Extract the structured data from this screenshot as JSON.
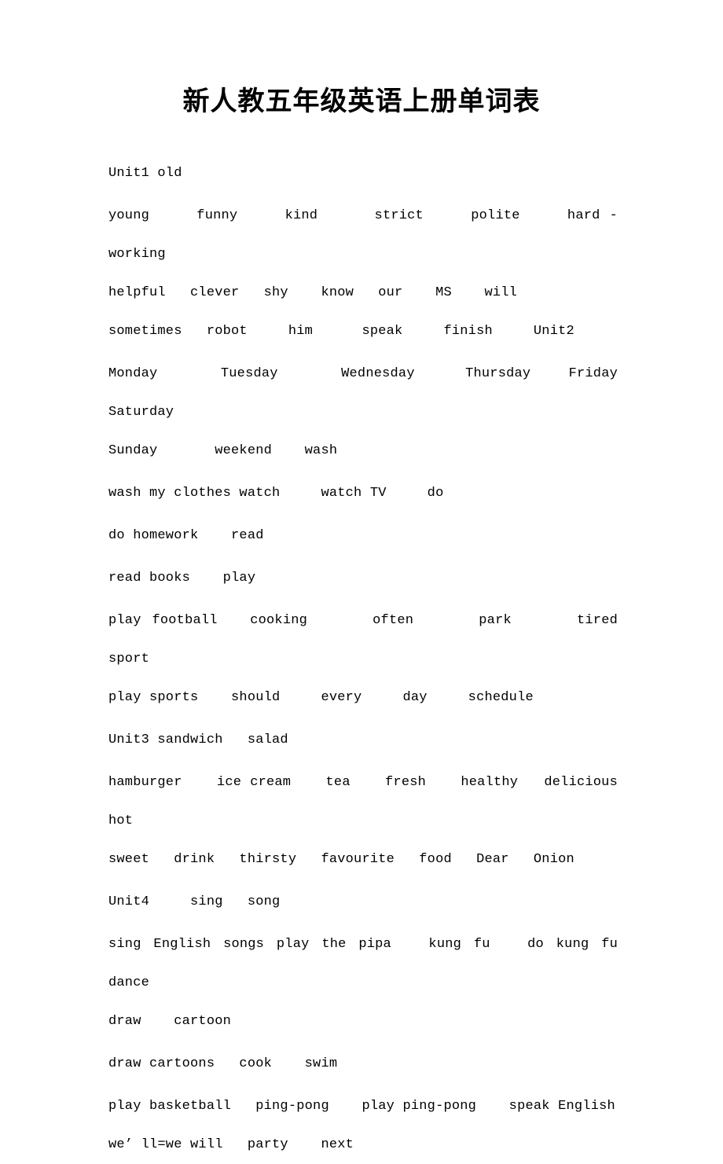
{
  "document": {
    "title": "新人教五年级英语上册单词表",
    "paragraphs": [
      {
        "id": "unit1-header",
        "text": "Unit1 old"
      },
      {
        "id": "unit1-words",
        "text": "young     funny     kind      strict     polite     hard -working\nhelpful   clever   shy    know   our    MS    will"
      },
      {
        "id": "unit1-words-cont",
        "text": "sometimes   robot     him      speak     finish     Unit2"
      },
      {
        "id": "unit2-weekdays",
        "text": "Monday     Tuesday     Wednesday    Thursday   Friday     Saturday\nSunday       weekend    wash"
      },
      {
        "id": "unit2-phrases-1",
        "text": "wash my clothes watch     watch TV     do"
      },
      {
        "id": "unit2-phrases-2",
        "text": "do homework    read"
      },
      {
        "id": "unit2-phrases-3",
        "text": "read books    play"
      },
      {
        "id": "unit2-phrases-4",
        "text": "play football   cooking      often      park      tired      sport\nplay sports    should     every     day     schedule"
      },
      {
        "id": "unit3-header",
        "text": "Unit3 sandwich   salad"
      },
      {
        "id": "unit3-words",
        "text": "hamburger    ice cream    tea    fresh    healthy   delicious   hot\nsweet   drink   thirsty   favourite   food   Dear   Onion"
      },
      {
        "id": "unit4-header",
        "text": "Unit4     sing   song"
      },
      {
        "id": "unit4-phrases-1",
        "text": "sing English songs play the pipa   kung fu   do kung fu   dance\ndraw    cartoon"
      },
      {
        "id": "unit4-phrases-2",
        "text": "draw cartoons   cook    swim"
      },
      {
        "id": "unit4-phrases-3",
        "text": "play basketball   ping-pong    play ping-pong    speak English\nwe’ ll=we will   party    next"
      }
    ]
  }
}
